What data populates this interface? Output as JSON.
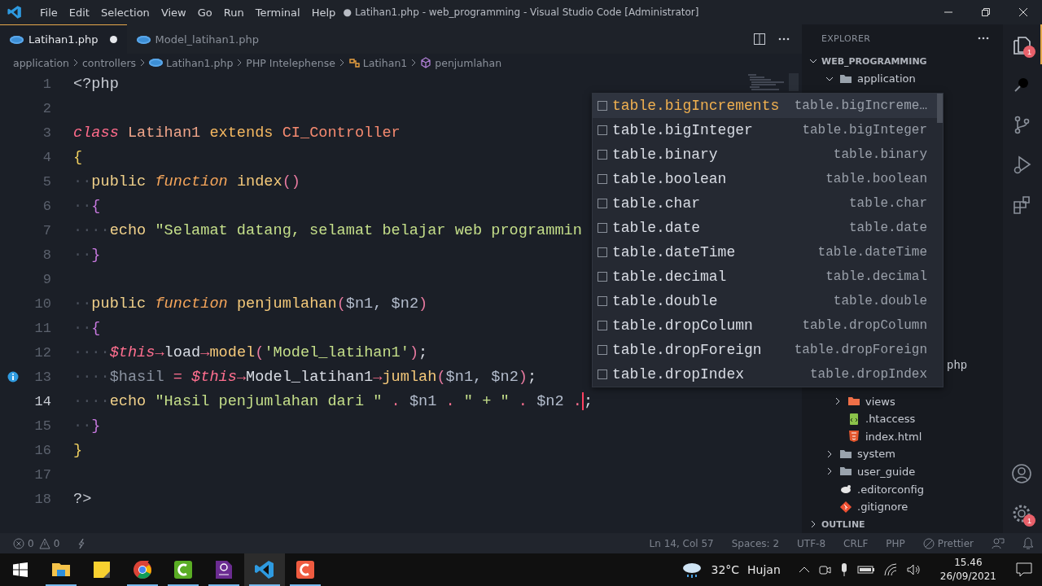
{
  "window": {
    "title": "● Latihan1.php - web_programming - Visual Studio Code [Administrator]"
  },
  "menu": [
    "File",
    "Edit",
    "Selection",
    "View",
    "Go",
    "Run",
    "Terminal",
    "Help"
  ],
  "tabs": [
    {
      "label": "Latihan1.php",
      "selected": true,
      "dirty": true
    },
    {
      "label": "Model_latihan1.php",
      "selected": false,
      "dirty": false
    }
  ],
  "breadcrumbs": [
    {
      "label": "application",
      "kind": "plain"
    },
    {
      "label": "controllers",
      "kind": "plain"
    },
    {
      "label": "Latihan1.php",
      "kind": "php"
    },
    {
      "label": "PHP Intelephense",
      "kind": "plain"
    },
    {
      "label": "Latihan1",
      "kind": "class"
    },
    {
      "label": "penjumlahan",
      "kind": "method"
    }
  ],
  "code": [
    {
      "number": "1",
      "tokens": [
        {
          "kind": "tag",
          "text": "<?php"
        }
      ]
    },
    {
      "number": "2"
    },
    {
      "number": "3",
      "tokens": [
        {
          "kind": "storage",
          "text": "class "
        },
        {
          "kind": "cls",
          "text": "Latihan1 "
        },
        {
          "kind": "ext",
          "text": "extends "
        },
        {
          "kind": "base",
          "text": "CI_Controller"
        }
      ]
    },
    {
      "number": "4",
      "tokens": [
        {
          "kind": "brace1",
          "text": "{"
        }
      ]
    },
    {
      "number": "5",
      "tokens": [
        {
          "kind": "ws",
          "text": "··"
        },
        {
          "kind": "mod",
          "text": "public "
        },
        {
          "kind": "fnkw",
          "text": "function "
        },
        {
          "kind": "fn",
          "text": "index"
        },
        {
          "kind": "punct",
          "text": "()"
        }
      ]
    },
    {
      "number": "6",
      "tokens": [
        {
          "kind": "ws",
          "text": "··"
        },
        {
          "kind": "brace2",
          "text": "{"
        }
      ]
    },
    {
      "number": "7",
      "tokens": [
        {
          "kind": "ws",
          "text": "····"
        },
        {
          "kind": "mod",
          "text": "echo "
        },
        {
          "kind": "str",
          "text": "\"Selamat datang, selamat belajar web programmin"
        }
      ]
    },
    {
      "number": "8",
      "tokens": [
        {
          "kind": "ws",
          "text": "··"
        },
        {
          "kind": "brace2",
          "text": "}"
        }
      ]
    },
    {
      "number": "9"
    },
    {
      "number": "10",
      "tokens": [
        {
          "kind": "ws",
          "text": "··"
        },
        {
          "kind": "mod",
          "text": "public "
        },
        {
          "kind": "fnkw",
          "text": "function "
        },
        {
          "kind": "fn",
          "text": "penjumlahan"
        },
        {
          "kind": "punct",
          "text": "("
        },
        {
          "kind": "var",
          "text": "$n1, $n2"
        },
        {
          "kind": "punct",
          "text": ")"
        }
      ]
    },
    {
      "number": "11",
      "tokens": [
        {
          "kind": "ws",
          "text": "··"
        },
        {
          "kind": "brace2",
          "text": "{"
        }
      ]
    },
    {
      "number": "12",
      "tokens": [
        {
          "kind": "ws",
          "text": "····"
        },
        {
          "kind": "this",
          "text": "$this"
        },
        {
          "kind": "op",
          "text": "→"
        },
        {
          "kind": "plain",
          "text": "load"
        },
        {
          "kind": "op",
          "text": "→"
        },
        {
          "kind": "fn",
          "text": "model"
        },
        {
          "kind": "punct",
          "text": "("
        },
        {
          "kind": "str",
          "text": "'Model_latihan1'"
        },
        {
          "kind": "punct",
          "text": ")"
        },
        {
          "kind": "plain",
          "text": ";"
        }
      ]
    },
    {
      "number": "13",
      "info_marker": true,
      "tokens": [
        {
          "kind": "ws",
          "text": "····"
        },
        {
          "kind": "vardim",
          "text": "$hasil "
        },
        {
          "kind": "op",
          "text": "= "
        },
        {
          "kind": "this",
          "text": "$this"
        },
        {
          "kind": "op",
          "text": "→"
        },
        {
          "kind": "plain",
          "text": "Model_latihan1"
        },
        {
          "kind": "op",
          "text": "→"
        },
        {
          "kind": "fn",
          "text": "jumlah"
        },
        {
          "kind": "punct",
          "text": "("
        },
        {
          "kind": "var",
          "text": "$n1, $n2"
        },
        {
          "kind": "punct",
          "text": ")"
        },
        {
          "kind": "plain",
          "text": ";"
        }
      ]
    },
    {
      "number": "14",
      "current": true,
      "tokens": [
        {
          "kind": "ws",
          "text": "····"
        },
        {
          "kind": "mod",
          "text": "echo "
        },
        {
          "kind": "str",
          "text": "\"Hasil penjumlahan dari \" "
        },
        {
          "kind": "op",
          "text": ". "
        },
        {
          "kind": "var",
          "text": "$n1 "
        },
        {
          "kind": "op",
          "text": ". "
        },
        {
          "kind": "str",
          "text": "\" + \" "
        },
        {
          "kind": "op",
          "text": ". "
        },
        {
          "kind": "var",
          "text": "$n2 "
        },
        {
          "kind": "op",
          "text": "."
        },
        {
          "kind": "caret"
        },
        {
          "kind": "plain",
          "text": ";"
        }
      ]
    },
    {
      "number": "15",
      "tokens": [
        {
          "kind": "ws",
          "text": "··"
        },
        {
          "kind": "brace2",
          "text": "}"
        }
      ]
    },
    {
      "number": "16",
      "tokens": [
        {
          "kind": "brace1",
          "text": "}"
        }
      ]
    },
    {
      "number": "17"
    },
    {
      "number": "18",
      "tokens": [
        {
          "kind": "tag",
          "text": "?>"
        }
      ]
    }
  ],
  "suggestions": [
    {
      "label": "table.bigIncrements",
      "detail": "table.bigIncreme…",
      "selected": true
    },
    {
      "label": "table.bigInteger",
      "detail": "table.bigInteger",
      "selected": false
    },
    {
      "label": "table.binary",
      "detail": "table.binary",
      "selected": false
    },
    {
      "label": "table.boolean",
      "detail": "table.boolean",
      "selected": false
    },
    {
      "label": "table.char",
      "detail": "table.char",
      "selected": false
    },
    {
      "label": "table.date",
      "detail": "table.date",
      "selected": false
    },
    {
      "label": "table.dateTime",
      "detail": "table.dateTime",
      "selected": false
    },
    {
      "label": "table.decimal",
      "detail": "table.decimal",
      "selected": false
    },
    {
      "label": "table.double",
      "detail": "table.double",
      "selected": false
    },
    {
      "label": "table.dropColumn",
      "detail": "table.dropColumn",
      "selected": false
    },
    {
      "label": "table.dropForeign",
      "detail": "table.dropForeign",
      "selected": false
    },
    {
      "label": "table.dropIndex",
      "detail": "table.dropIndex",
      "selected": false
    }
  ],
  "explorer": {
    "title": "EXPLORER",
    "root": "WEB_PROGRAMMING",
    "outline": "OUTLINE",
    "items": [
      {
        "label": "application",
        "kind": "folder",
        "expanded": true,
        "children": [
          {
            "label": "php",
            "kind": "partial"
          },
          {
            "label": "views",
            "kind": "views",
            "expanded": false
          },
          {
            "label": ".htaccess",
            "kind": "htaccess"
          },
          {
            "label": "index.html",
            "kind": "html"
          }
        ]
      },
      {
        "label": "system",
        "kind": "folder",
        "expanded": false
      },
      {
        "label": "user_guide",
        "kind": "folder",
        "expanded": false
      },
      {
        "label": ".editorconfig",
        "kind": "editorconfig"
      },
      {
        "label": ".gitignore",
        "kind": "git"
      }
    ]
  },
  "activity": [
    {
      "kind": "explorer",
      "badge": "1",
      "selected": true
    },
    {
      "kind": "search",
      "selected": false
    },
    {
      "kind": "scm",
      "selected": false
    },
    {
      "kind": "debug",
      "selected": false
    },
    {
      "kind": "extensions",
      "selected": false
    },
    {
      "kind": "spacer"
    },
    {
      "kind": "account",
      "selected": false
    },
    {
      "kind": "gear",
      "badge": "1",
      "selected": false
    }
  ],
  "status_bar": {
    "errors": "0",
    "warnings": "0",
    "right": [
      "Ln 14, Col 57",
      "Spaces: 2",
      "UTF-8",
      "CRLF",
      "PHP"
    ],
    "formatter": "Prettier"
  },
  "taskbar": {
    "apps": [
      {
        "kind": "files",
        "running": true,
        "active": false
      },
      {
        "kind": "notes",
        "running": false,
        "active": false
      },
      {
        "kind": "browser",
        "running": true,
        "active": false
      },
      {
        "kind": "recorder",
        "running": true,
        "active": false
      },
      {
        "kind": "pdf",
        "running": true,
        "active": false
      },
      {
        "kind": "vscode",
        "running": true,
        "active": true
      },
      {
        "kind": "editor",
        "running": true,
        "active": false
      }
    ],
    "temperature": "32°C",
    "weather": "Hujan",
    "time": "15.46",
    "date": "26/09/2021"
  }
}
